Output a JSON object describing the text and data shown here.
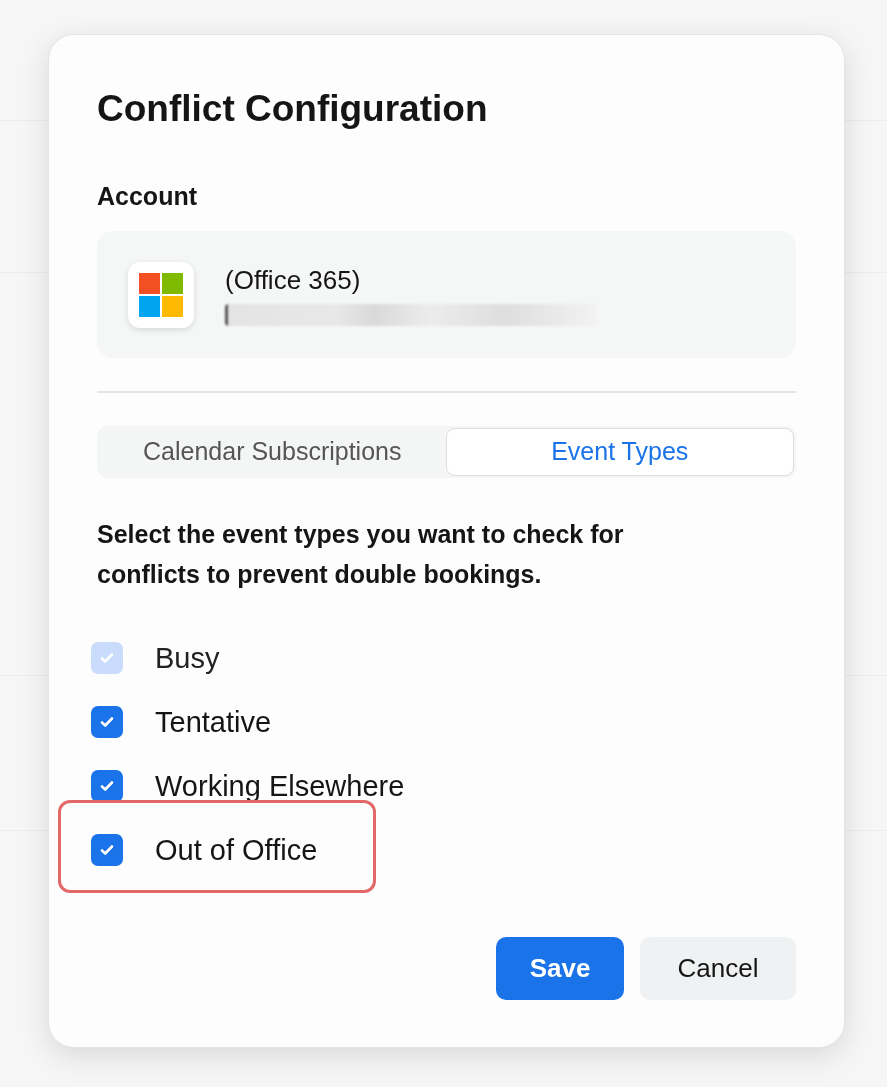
{
  "dialog": {
    "title": "Conflict Configuration"
  },
  "account": {
    "label": "Account",
    "name": "(Office 365)"
  },
  "tabs": [
    {
      "label": "Calendar Subscriptions",
      "selected": false
    },
    {
      "label": "Event Types",
      "selected": true
    }
  ],
  "description": "Select the event types you want to check for conflicts to prevent double bookings.",
  "event_types": [
    {
      "label": "Busy",
      "checked": true,
      "disabled": true,
      "highlighted": false
    },
    {
      "label": "Tentative",
      "checked": true,
      "disabled": false,
      "highlighted": false
    },
    {
      "label": "Working Elsewhere",
      "checked": true,
      "disabled": false,
      "highlighted": false
    },
    {
      "label": "Out of Office",
      "checked": true,
      "disabled": false,
      "highlighted": true
    }
  ],
  "buttons": [
    {
      "label": "Save",
      "kind": "primary"
    },
    {
      "label": "Cancel",
      "kind": "secondary"
    }
  ]
}
